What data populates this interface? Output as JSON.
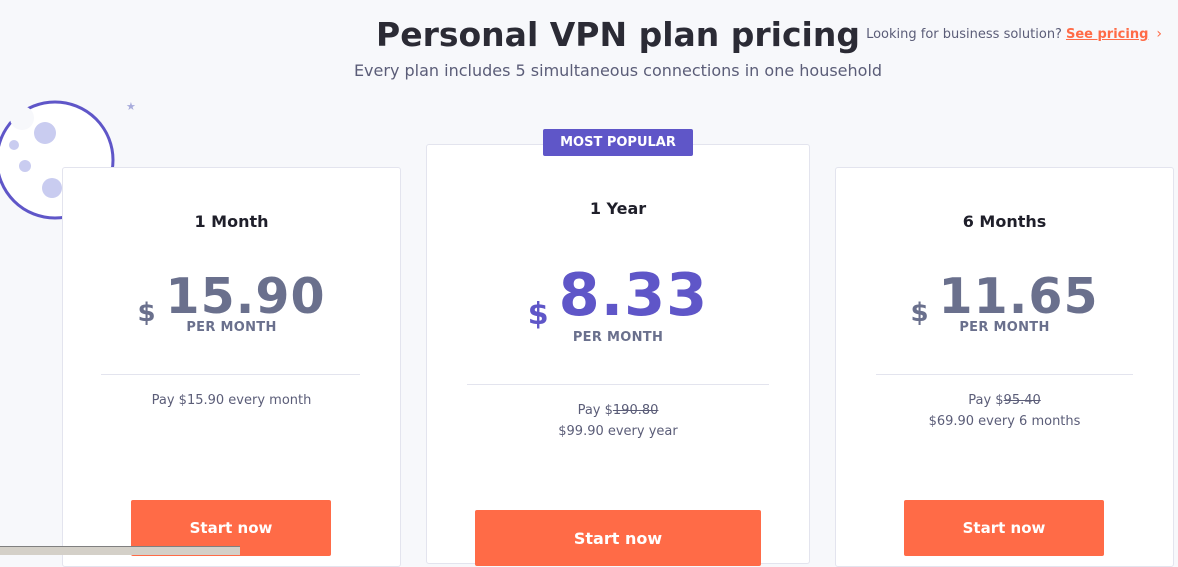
{
  "header": {
    "title": "Personal VPN plan pricing",
    "subtitle": "Every plan includes 5 simultaneous connections in one household"
  },
  "business": {
    "prompt": "Looking for business solution?",
    "link": "See pricing",
    "chevron": "›"
  },
  "badge": "MOST POPULAR",
  "plans": [
    {
      "name": "1 Month",
      "currency": "$",
      "amount": "15.90",
      "per": "PER MONTH",
      "pay_prefix": "Pay $15.90 every month",
      "button": "Start now"
    },
    {
      "name": "1 Year",
      "currency": "$",
      "amount": "8.33",
      "per": "PER MONTH",
      "pay_prefix": "Pay $",
      "pay_strike": "190.80",
      "pay_line2": "$99.90 every year",
      "button": "Start now"
    },
    {
      "name": "6 Months",
      "currency": "$",
      "amount": "11.65",
      "per": "PER MONTH",
      "pay_prefix": "Pay $",
      "pay_strike": "95.40",
      "pay_line2": "$69.90 every 6 months",
      "button": "Start now"
    }
  ],
  "colors": {
    "accent": "#ff6b47",
    "primary": "#5f56c8",
    "text_muted": "#6a708d"
  },
  "icons": {
    "moon": "moon-illustration",
    "star": "star-icon",
    "chevron": "chevron-right-icon"
  }
}
